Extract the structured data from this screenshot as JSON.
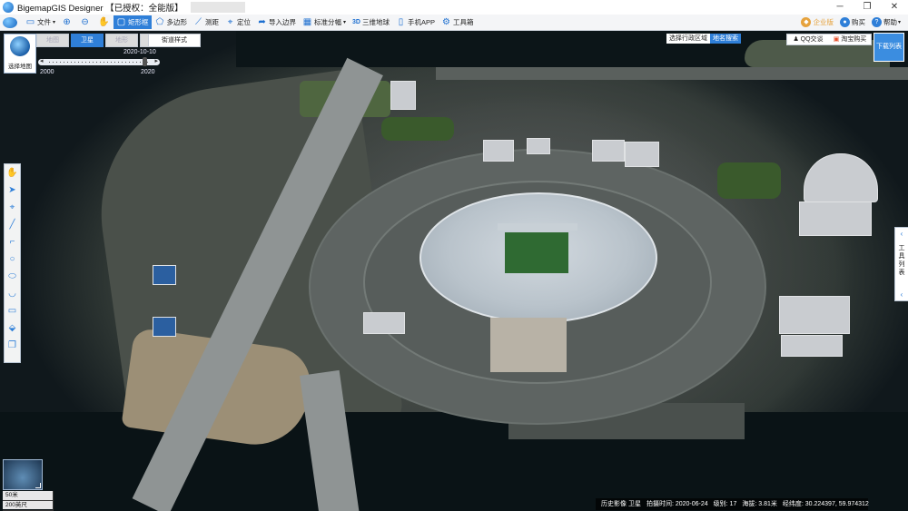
{
  "app": {
    "title": "BigemapGIS Designer 【已授权：全能版】"
  },
  "window_controls": {
    "minimize": "─",
    "maximize": "❐",
    "close": "✕"
  },
  "toolbar": {
    "items": [
      {
        "label": "文件",
        "icon": "folder-icon",
        "glyph": "▭"
      },
      {
        "label": "",
        "icon": "zoom-in-icon",
        "glyph": "⊕"
      },
      {
        "label": "",
        "icon": "zoom-out-icon",
        "glyph": "⊖"
      },
      {
        "label": "",
        "icon": "pan-hand-icon",
        "glyph": "✋"
      },
      {
        "label": "矩形框",
        "icon": "rectangle-select-icon",
        "glyph": "▢",
        "active": true
      },
      {
        "label": "多边形",
        "icon": "polygon-icon",
        "glyph": "⬠"
      },
      {
        "label": "测距",
        "icon": "ruler-icon",
        "glyph": "⟋"
      },
      {
        "label": "定位",
        "icon": "location-pin-icon",
        "glyph": "⌖"
      },
      {
        "label": "导入边界",
        "icon": "import-boundary-icon",
        "glyph": "➦"
      },
      {
        "label": "标准分幅",
        "icon": "grid-icon",
        "glyph": "▦"
      },
      {
        "label": "三维地球",
        "icon": "3d-globe-icon",
        "glyph": "3D"
      },
      {
        "label": "手机APP",
        "icon": "mobile-app-icon",
        "glyph": "▯"
      },
      {
        "label": "工具箱",
        "icon": "gear-toolbox-icon",
        "glyph": "⚙"
      }
    ],
    "right": [
      {
        "label": "企业版",
        "icon": "enterprise-icon",
        "glyph": "◆",
        "color": "#e6a23c"
      },
      {
        "label": "购买",
        "icon": "buy-icon",
        "glyph": "●",
        "color": "#2f7fd8"
      },
      {
        "label": "帮助",
        "icon": "help-icon",
        "glyph": "?",
        "color": "#2f7fd8"
      }
    ]
  },
  "map_panel": {
    "choose_map_label": "选择地图",
    "map_types": [
      {
        "label": "地图",
        "active": false
      },
      {
        "label": "卫星",
        "active": true
      },
      {
        "label": "地形",
        "active": false
      },
      {
        "label": "卫星",
        "active": false
      }
    ],
    "street_style": "街道样式",
    "timeline": {
      "date": "2020-10-10",
      "start_year": "2000",
      "end_year": "2020",
      "position": 0.95
    }
  },
  "top_right": {
    "region_label": "选择行政区域",
    "search_label": "地名搜索",
    "qq_label": "QQ交谈",
    "taobao_label": "淘宝购买",
    "download_list": "下载列表"
  },
  "left_tools": [
    {
      "icon": "hand-icon",
      "glyph": "✋"
    },
    {
      "icon": "pointer-icon",
      "glyph": "➤"
    },
    {
      "icon": "marker-icon",
      "glyph": "⌖"
    },
    {
      "icon": "line-icon",
      "glyph": "╱"
    },
    {
      "icon": "polyline-icon",
      "glyph": "⌐"
    },
    {
      "icon": "circle-icon",
      "glyph": "○"
    },
    {
      "icon": "ellipse-icon",
      "glyph": "⬭"
    },
    {
      "icon": "arc-icon",
      "glyph": "◡"
    },
    {
      "icon": "rectangle-icon",
      "glyph": "▭"
    },
    {
      "icon": "eraser-icon",
      "glyph": "⬙"
    },
    {
      "icon": "layers-icon",
      "glyph": "❐"
    }
  ],
  "right_panel": {
    "label": "工具列表",
    "up_arrow": "‹",
    "down_arrow": "‹"
  },
  "scale": {
    "top": "50米",
    "bottom": "200英尺"
  },
  "status": {
    "imagery": "历史影像 卫星",
    "capture_time": "拍摄时间: 2020-06-24",
    "level": "级别: 17",
    "altitude": "海拔: 3.81米",
    "coords": "经纬度: 30.224397, 59.974312"
  }
}
